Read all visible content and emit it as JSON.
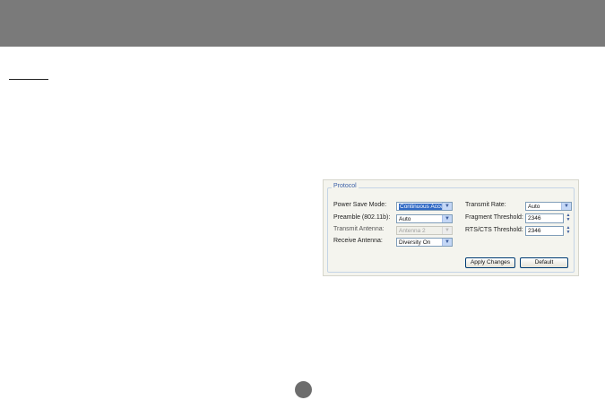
{
  "protocol_panel": {
    "legend": "Protocol",
    "left": {
      "power_save_mode": {
        "label": "Power Save Mode:",
        "value": "Continuous Access"
      },
      "preamble": {
        "label": "Preamble (802.11b):",
        "value": "Auto"
      },
      "transmit_antenna": {
        "label": "Transmit Antenna:",
        "value": "Antenna 2"
      },
      "receive_antenna": {
        "label": "Receive Antenna:",
        "value": "Diversity On"
      }
    },
    "right": {
      "transmit_rate": {
        "label": "Transmit Rate:",
        "value": "Auto"
      },
      "fragment_threshold": {
        "label": "Fragment Threshold:",
        "value": "2346"
      },
      "rts_cts_threshold": {
        "label": "RTS/CTS Threshold:",
        "value": "2346"
      }
    },
    "buttons": {
      "apply_changes": "Apply Changes",
      "default": "Default"
    }
  },
  "icons": {
    "dropdown": "chevron-down-icon",
    "spin_up": "arrow-up-icon",
    "spin_down": "arrow-down-icon"
  },
  "colors": {
    "header_band": "#7a7a7a",
    "selection_highlight": "#316ac5",
    "group_border": "#c4d4e6"
  }
}
